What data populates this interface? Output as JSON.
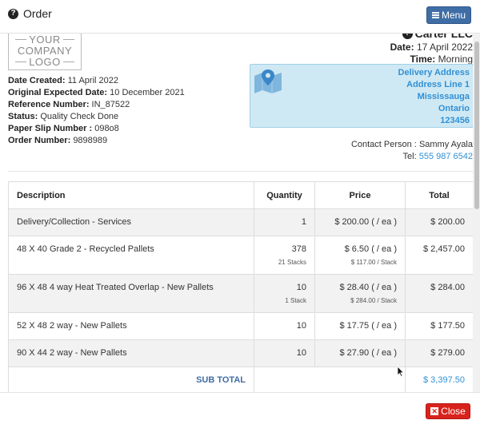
{
  "header": {
    "title": "Order",
    "menu_label": "Menu"
  },
  "logo": {
    "line1": "YOUR",
    "line2": "COMPANY",
    "line3": "LOGO"
  },
  "company": {
    "name": "Carter LLC"
  },
  "meta": {
    "date_label": "Date:",
    "date": "17 April 2022",
    "time_label": "Time:",
    "time": "Morning"
  },
  "info": {
    "date_created_label": "Date Created:",
    "date_created": "11 April 2022",
    "original_expected_label": "Original Expected Date:",
    "original_expected": "10 December 2021",
    "reference_label": "Reference Number:",
    "reference": "IN_87522",
    "status_label": "Status:",
    "status": "Quality Check Done",
    "paper_slip_label": "Paper Slip Number :",
    "paper_slip": "098o8",
    "order_number_label": "Order Number:",
    "order_number": "9898989"
  },
  "delivery": {
    "title": "Delivery Address",
    "line1": "Address Line 1",
    "city": "Mississauga",
    "province": "Ontario",
    "postal": "123456"
  },
  "contact": {
    "person_label": "Contact Person :",
    "person": "Sammy Ayala",
    "tel_label": "Tel:",
    "tel": "555 987 6542"
  },
  "table": {
    "headers": {
      "description": "Description",
      "quantity": "Quantity",
      "price": "Price",
      "total": "Total"
    },
    "rows": [
      {
        "description": "Delivery/Collection - Services",
        "quantity": "1",
        "quantity_sub": "",
        "price": "$ 200.00 ( / ea )",
        "price_sub": "",
        "total": "$ 200.00"
      },
      {
        "description": "48 X 40 Grade 2 - Recycled Pallets",
        "quantity": "378",
        "quantity_sub": "21 Stacks",
        "price": "$ 6.50 ( / ea )",
        "price_sub": "$ 117.00 / Stack",
        "total": "$ 2,457.00"
      },
      {
        "description": "96 X 48 4 way Heat Treated Overlap - New Pallets",
        "quantity": "10",
        "quantity_sub": "1 Stack",
        "price": "$ 28.40 ( / ea )",
        "price_sub": "$ 284.00 / Stack",
        "total": "$ 284.00"
      },
      {
        "description": "52 X 48 2 way - New Pallets",
        "quantity": "10",
        "quantity_sub": "",
        "price": "$ 17.75 ( / ea )",
        "price_sub": "",
        "total": "$ 177.50"
      },
      {
        "description": "90 X 44 2 way - New Pallets",
        "quantity": "10",
        "quantity_sub": "",
        "price": "$ 27.90 ( / ea )",
        "price_sub": "",
        "total": "$ 279.00"
      }
    ],
    "subtotal_label": "SUB TOTAL",
    "subtotal": "$ 3,397.50"
  },
  "footer": {
    "close_label": "Close"
  },
  "colors": {
    "accent": "#3f6ea6",
    "link": "#3190d4",
    "danger": "#d9221c",
    "delivery_bg": "#cfe9f4"
  }
}
